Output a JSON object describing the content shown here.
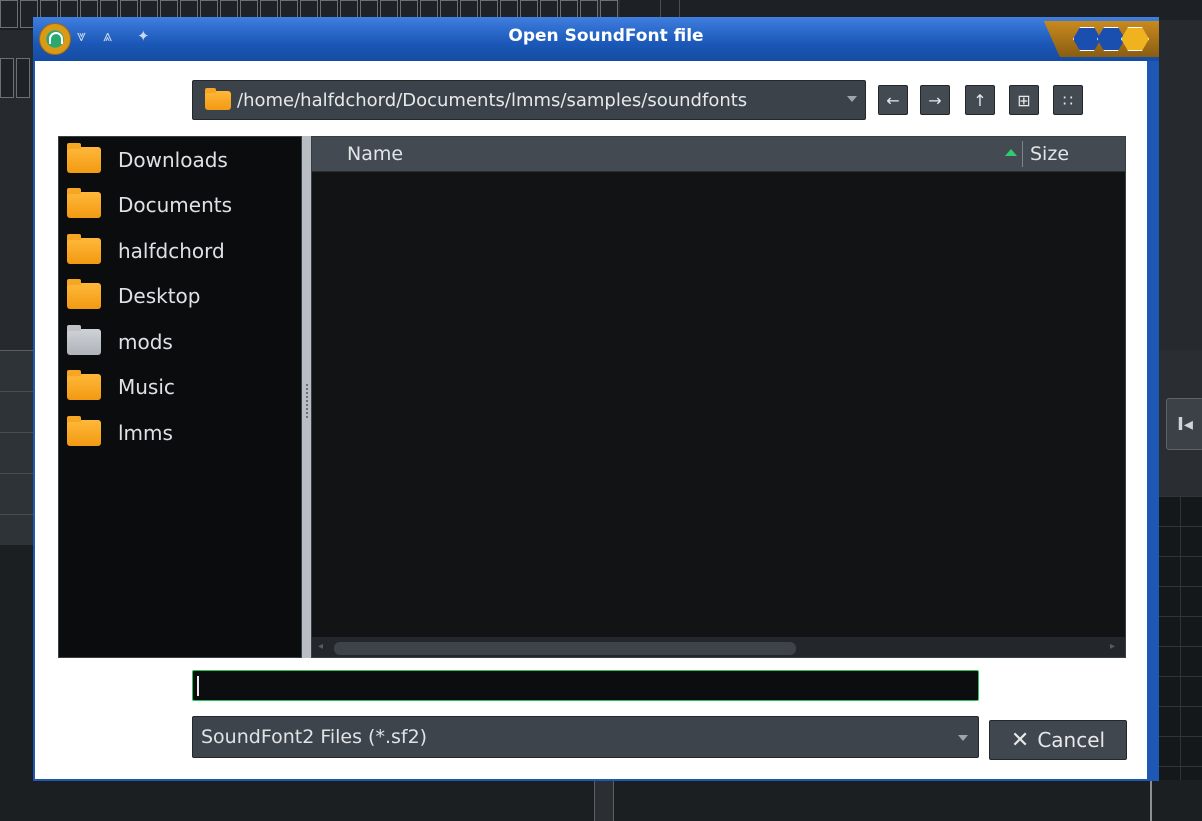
{
  "dialog": {
    "title": "Open SoundFont file",
    "titlebar_buttons": [
      "chevrons-down-icon",
      "chevrons-up-icon",
      "pin-icon"
    ]
  },
  "path_combo": {
    "value": "/home/halfdchord/Documents/lmms/samples/soundfonts"
  },
  "nav_buttons": [
    {
      "name": "back-button",
      "icon": "←"
    },
    {
      "name": "forward-button",
      "icon": "→"
    },
    {
      "name": "parent-directory-button",
      "icon": "↑"
    },
    {
      "name": "new-folder-button",
      "icon": "⊞"
    },
    {
      "name": "view-mode-button",
      "icon": "∷"
    }
  ],
  "sidebar": {
    "items": [
      {
        "label": "Downloads",
        "icon": "folder-icon"
      },
      {
        "label": "Documents",
        "icon": "folder-icon"
      },
      {
        "label": "halfdchord",
        "icon": "folder-icon"
      },
      {
        "label": "Desktop",
        "icon": "folder-icon"
      },
      {
        "label": "mods",
        "icon": "folder-grey-icon"
      },
      {
        "label": "Music",
        "icon": "folder-icon"
      },
      {
        "label": "lmms",
        "icon": "folder-icon"
      }
    ]
  },
  "file_list": {
    "columns": [
      "Name",
      "Size"
    ],
    "rows": []
  },
  "filename_input": {
    "value": ""
  },
  "filter": {
    "value": "SoundFont2 Files (*.sf2)"
  },
  "cancel_button": {
    "label": "Cancel"
  },
  "background": {
    "transport_button_icon": "I◂"
  },
  "colors": {
    "titlebar": "#1f58b4",
    "accent_green": "#27c258",
    "folder": "#f6a623"
  }
}
